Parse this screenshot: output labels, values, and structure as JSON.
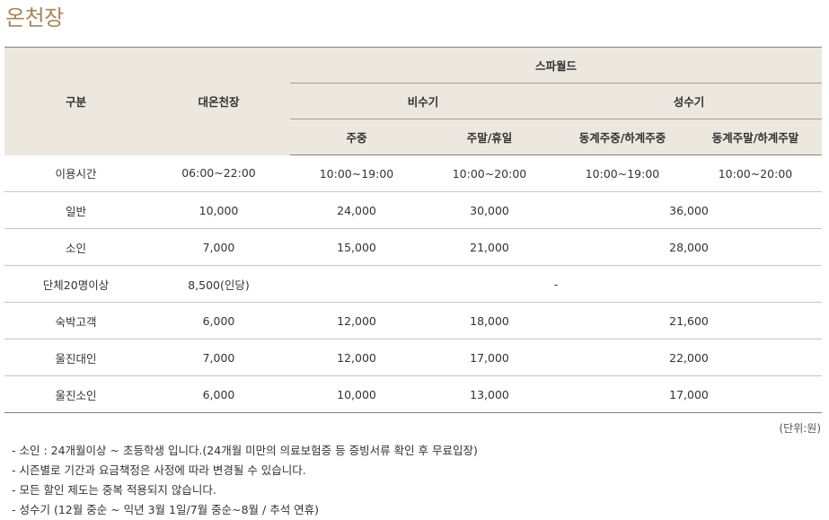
{
  "title": "온천장",
  "table": {
    "header": {
      "category": "구분",
      "daeoncheonjang": "대온천장",
      "spaworld": "스파월드",
      "offseason": "비수기",
      "peakseason": "성수기",
      "weekday": "주중",
      "weekend_holiday": "주말/휴일",
      "peak_weekday": "동계주중/하계주중",
      "peak_weekend": "동계주말/하계주말"
    },
    "rows": [
      {
        "label": "이용시간",
        "dae": "06:00~22:00",
        "off_weekday": "10:00~19:00",
        "off_weekend": "10:00~20:00",
        "peak_weekday": "10:00~19:00",
        "peak_weekend": "10:00~20:00"
      },
      {
        "label": "일반",
        "dae": "10,000",
        "off_weekday": "24,000",
        "off_weekend": "30,000",
        "peak": "36,000"
      },
      {
        "label": "소인",
        "dae": "7,000",
        "off_weekday": "15,000",
        "off_weekend": "21,000",
        "peak": "28,000"
      },
      {
        "label": "단체20명이상",
        "dae": "8,500(인당)",
        "spa": "-"
      },
      {
        "label": "숙박고객",
        "dae": "6,000",
        "off_weekday": "12,000",
        "off_weekend": "18,000",
        "peak": "21,600"
      },
      {
        "label": "울진대인",
        "dae": "7,000",
        "off_weekday": "12,000",
        "off_weekend": "17,000",
        "peak": "22,000"
      },
      {
        "label": "울진소인",
        "dae": "6,000",
        "off_weekday": "10,000",
        "off_weekend": "13,000",
        "peak": "17,000"
      }
    ]
  },
  "unit_note": "(단위:원)",
  "notes": [
    "- 소인 : 24개월이상 ~ 초등학생 입니다.(24개월 미만의 의료보험증 등 증빙서류 확인 후 무료입장)",
    "- 시즌별로 기간과 요금책정은 사정에 따라 변경될 수 있습니다.",
    "- 모든 할인 제도는 중복 적용되지 않습니다.",
    "- 성수기 (12월 중순 ~ 익년 3월 1일/7월 중순~8월 / 추석 연휴)"
  ]
}
